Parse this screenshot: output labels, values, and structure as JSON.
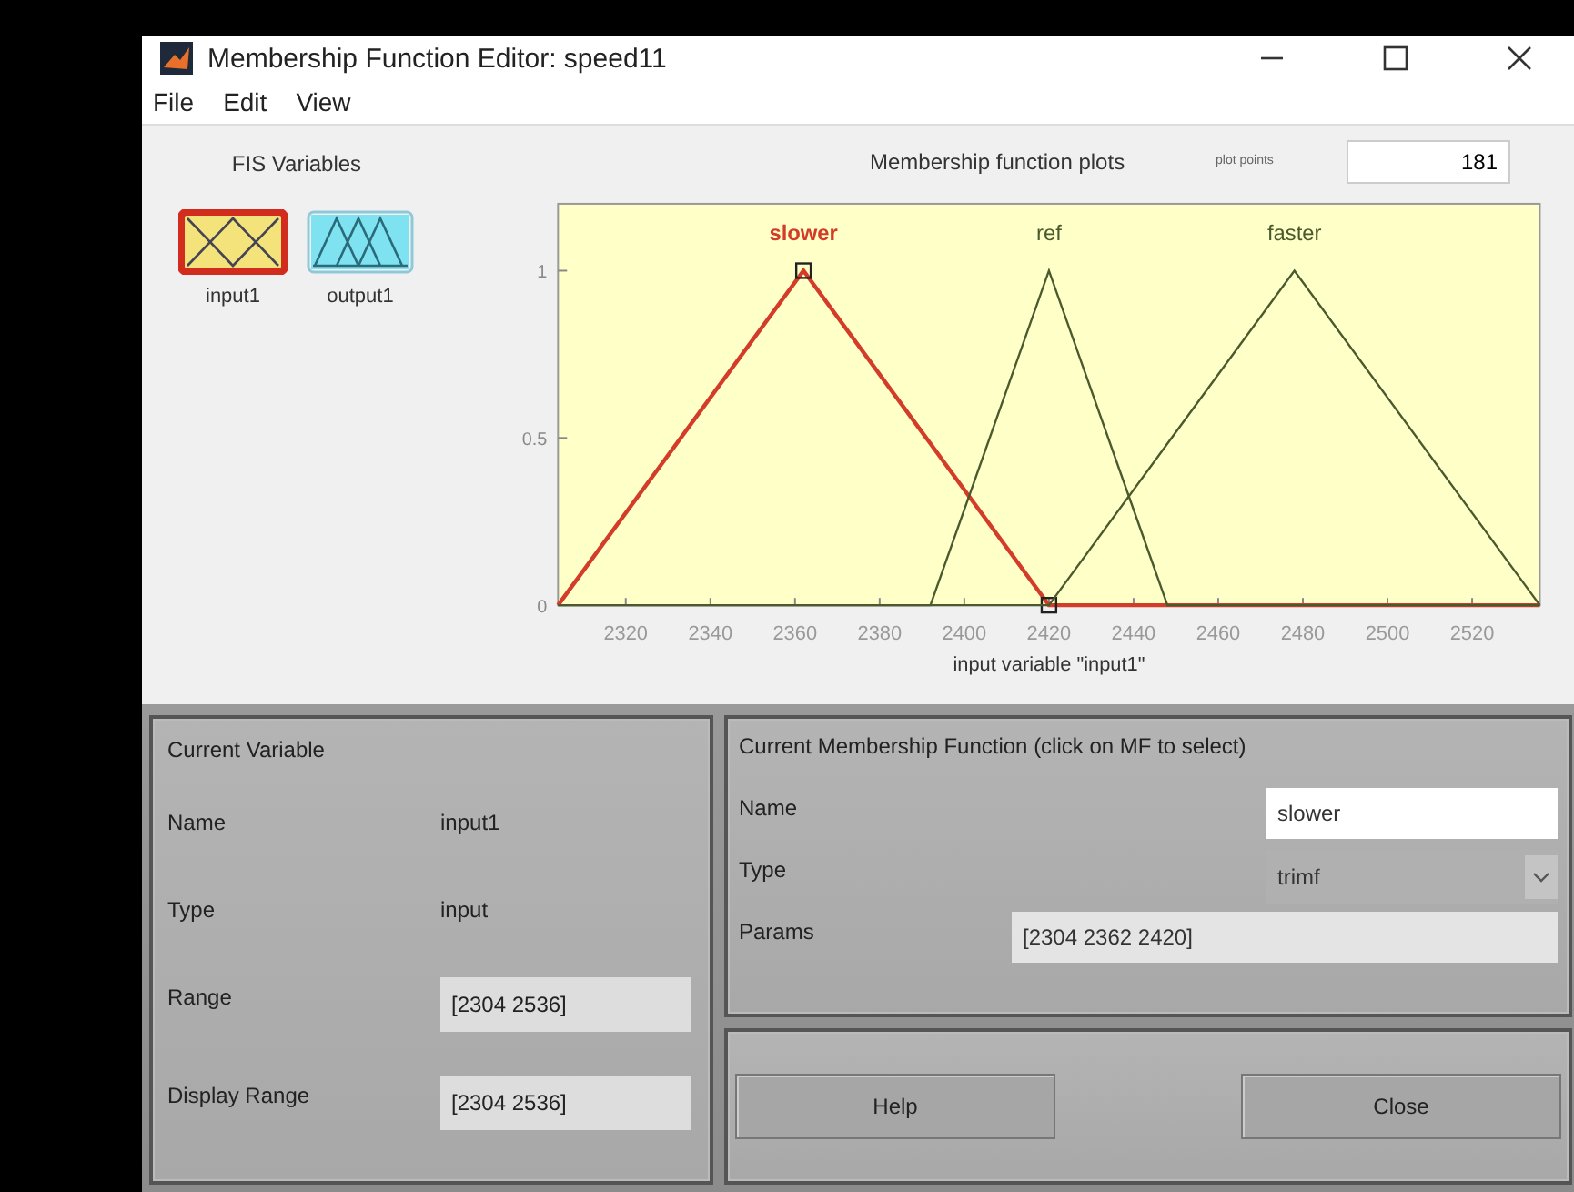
{
  "window": {
    "title": "Membership Function Editor: speed11"
  },
  "menu": [
    "File",
    "Edit",
    "View"
  ],
  "fis_variables": {
    "title": "FIS Variables",
    "items": [
      {
        "label": "input1",
        "kind": "input",
        "selected": true
      },
      {
        "label": "output1",
        "kind": "output",
        "selected": false
      }
    ]
  },
  "plot": {
    "plot_points_label": "plot points",
    "plot_points": "181",
    "chart_data": {
      "type": "line",
      "title": "Membership function plots",
      "xlabel": "input variable \"input1\"",
      "x": [
        2304,
        2362,
        2392,
        2420,
        2448,
        2478,
        2536
      ],
      "xlim": [
        2304,
        2536
      ],
      "ylim": [
        0,
        1.2
      ],
      "xticks": [
        2320,
        2340,
        2360,
        2380,
        2400,
        2420,
        2440,
        2460,
        2480,
        2500,
        2520
      ],
      "yticks": [
        0,
        0.5,
        1
      ],
      "series": [
        {
          "name": "slower",
          "color": "#d23c28",
          "values": [
            0,
            1,
            0.483,
            0,
            0,
            0,
            0
          ]
        },
        {
          "name": "ref",
          "color": "#4b5a2e",
          "values": [
            0,
            0,
            0,
            1,
            0,
            0,
            0
          ]
        },
        {
          "name": "faster",
          "color": "#4b5a2e",
          "values": [
            0,
            0,
            0,
            0,
            0.483,
            1,
            0
          ]
        }
      ]
    },
    "curves": [
      {
        "selected": true
      },
      {
        "selected": false
      },
      {
        "selected": false
      }
    ]
  },
  "current_variable": {
    "title": "Current Variable",
    "name_label": "Name",
    "name": "input1",
    "type_label": "Type",
    "type": "input",
    "range_label": "Range",
    "range": "[2304 2536]",
    "display_range_label": "Display Range",
    "display_range": "[2304 2536]"
  },
  "current_mf": {
    "title": "Current Membership Function (click on MF to select)",
    "name_label": "Name",
    "name": "slower",
    "type_label": "Type",
    "type": "trimf",
    "params_label": "Params",
    "params": "[2304 2362 2420]"
  },
  "buttons": [
    "Help",
    "Close"
  ]
}
